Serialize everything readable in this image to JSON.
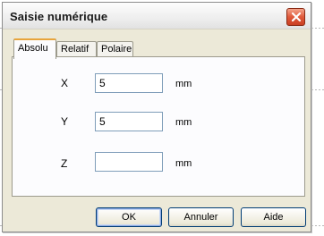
{
  "window": {
    "title": "Saisie numérique"
  },
  "tabs": [
    {
      "label": "Absolu",
      "active": true
    },
    {
      "label": "Relatif",
      "active": false
    },
    {
      "label": "Polaire",
      "active": false
    }
  ],
  "fields": [
    {
      "label": "X",
      "value": "5",
      "unit": "mm"
    },
    {
      "label": "Y",
      "value": "5",
      "unit": "mm"
    },
    {
      "label": "Z",
      "value": "",
      "unit": "mm"
    }
  ],
  "buttons": {
    "ok": "OK",
    "cancel": "Annuler",
    "help": "Aide"
  },
  "colors": {
    "dialog_bg": "#ece9d8",
    "close_button": "#e0593a",
    "active_tab_accent": "#e8a53c",
    "field_border": "#7f9db9"
  }
}
